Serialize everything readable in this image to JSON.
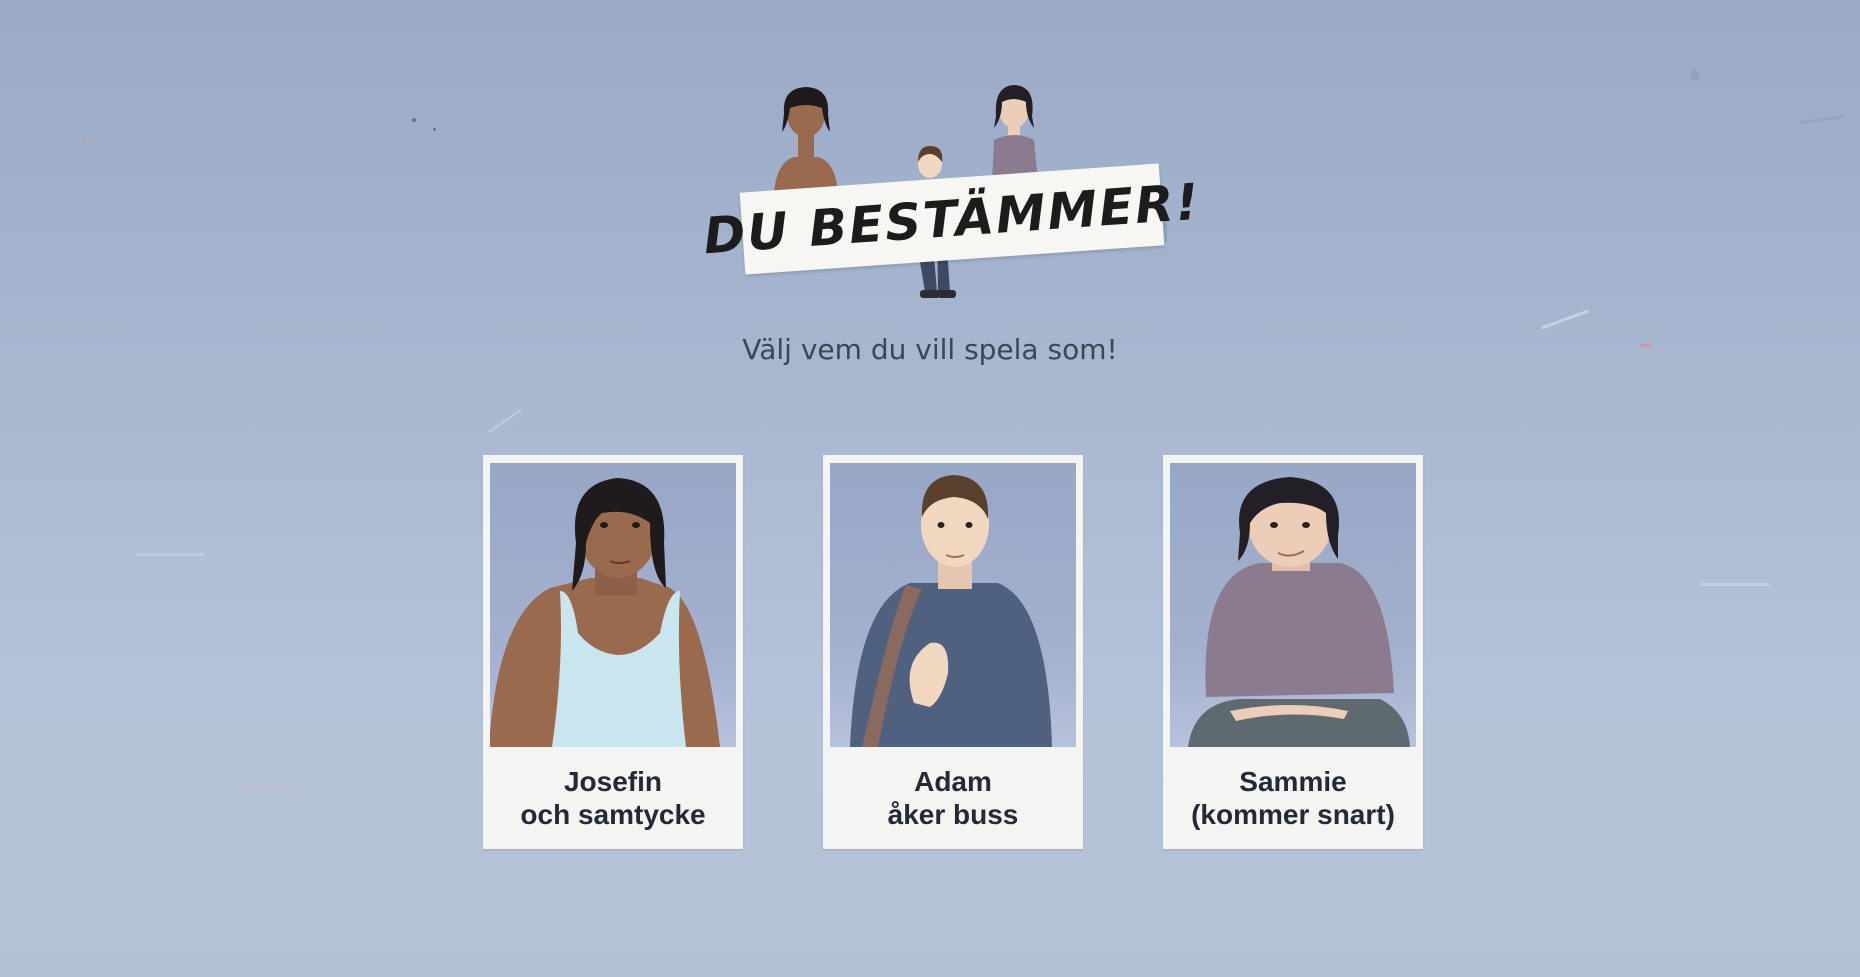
{
  "app": {
    "logo_text": "DU BESTÄMMER!",
    "subtitle": "Välj vem du vill spela som!"
  },
  "characters": [
    {
      "id": "josefin",
      "line1": "Josefin",
      "line2": "och samtycke",
      "skin": "#9a6a4f",
      "hair": "#1f1a1c",
      "top": "#c9e6ee"
    },
    {
      "id": "adam",
      "line1": "Adam",
      "line2": "åker buss",
      "skin": "#f1d7c0",
      "hair": "#5a3f2d",
      "top": "#4f617f"
    },
    {
      "id": "sammie",
      "line1": "Sammie",
      "line2": "(kommer snart)",
      "skin": "#eccdb8",
      "hair": "#222026",
      "top": "#8a7b8f"
    }
  ],
  "colors": {
    "background_top": "#9aaac6",
    "background_bottom": "#b6c4da",
    "card_bg": "#f4f4f2",
    "label_text": "#232a36"
  }
}
